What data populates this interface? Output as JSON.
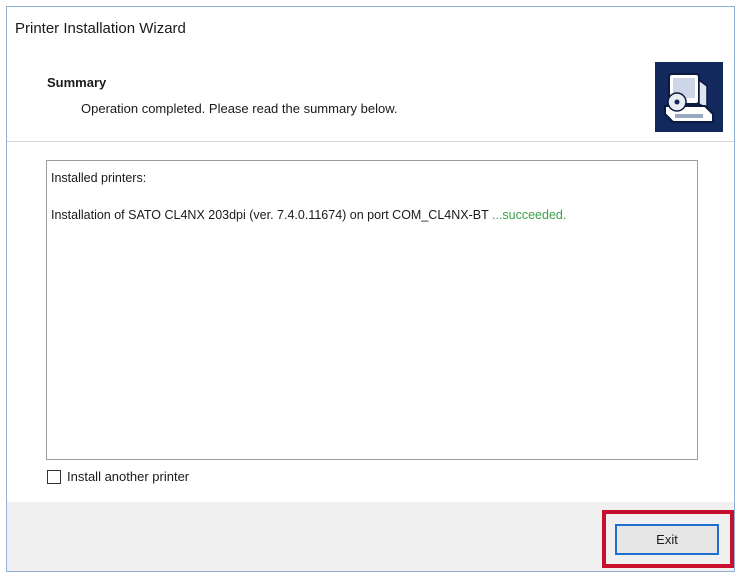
{
  "window": {
    "title": "Printer Installation Wizard"
  },
  "header": {
    "title": "Summary",
    "subtitle": "Operation completed. Please read the summary below.",
    "icon": "printer-setup-icon"
  },
  "summary": {
    "heading": "Installed printers:",
    "entries": [
      {
        "text": "Installation of SATO CL4NX 203dpi (ver. 7.4.0.11674) on port COM_CL4NX-BT ",
        "status": "...succeeded.",
        "status_color": "#3aa24a"
      }
    ]
  },
  "options": {
    "install_another_label": "Install another printer",
    "install_another_checked": false
  },
  "footer": {
    "exit_label": "Exit",
    "highlight_color": "#c8102e"
  }
}
